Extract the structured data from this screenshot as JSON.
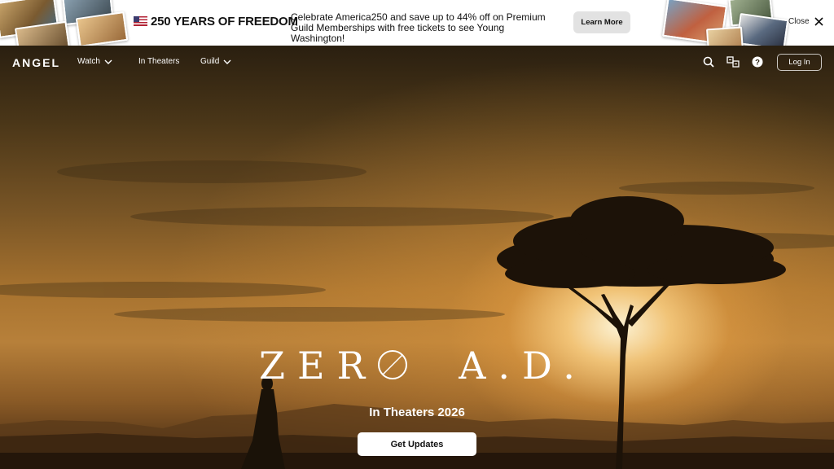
{
  "banner": {
    "title": "250 YEARS OF FREEDOM",
    "flag_icon": "us-flag-icon",
    "text": "Celebrate America250 and save up to 44% off on Premium Guild Memberships with free tickets to see Young Washington!",
    "learn_more": "Learn More",
    "close_label": "Close"
  },
  "nav": {
    "logo": "ANGEL",
    "items": [
      {
        "label": "Watch",
        "has_dropdown": true
      },
      {
        "label": "In Theaters",
        "has_dropdown": false
      },
      {
        "label": "Guild",
        "has_dropdown": true
      }
    ],
    "icons": [
      "search-icon",
      "translate-icon",
      "help-icon"
    ],
    "login": "Log In"
  },
  "hero": {
    "title_left": "ZER",
    "title_right": "A.D.",
    "subtitle": "In Theaters 2026",
    "cta": "Get Updates"
  },
  "colors": {
    "accent_button_bg": "#ffffff",
    "banner_bg": "#ffffff",
    "learn_more_bg": "#e2e2e2"
  }
}
